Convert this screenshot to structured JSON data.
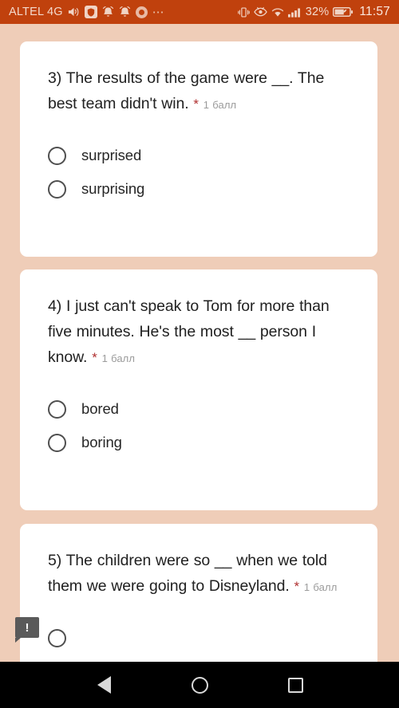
{
  "statusbar": {
    "carrier": "ALTEL 4G",
    "icons_left": [
      "volume-icon",
      "shield-icon",
      "alarm-icon",
      "notification-bell-icon",
      "chrome-icon"
    ],
    "overflow": "⋯",
    "icons_right": [
      "vibrate-icon",
      "eye-icon",
      "wifi-icon",
      "signal-bars-icon"
    ],
    "battery_percent": "32%",
    "battery_icon": "battery-icon",
    "time": "11:57",
    "bg_color": "#c0410d",
    "text_color": "#f3d9cc"
  },
  "theme": {
    "page_bg": "#efcdb8",
    "card_bg": "#ffffff",
    "text_color": "#222222",
    "points_color": "#9b9b9b",
    "required_color": "#b03030"
  },
  "questions": [
    {
      "number": "3)",
      "text": "3) The results of the game were __. The best team didn't win.",
      "points": "1 балл",
      "required_marker": "*",
      "options": [
        {
          "label": "surprised",
          "selected": false
        },
        {
          "label": "surprising",
          "selected": false
        }
      ]
    },
    {
      "number": "4)",
      "text": "4) I just can't speak to Tom for more than five minutes. He's the most __ person I know.",
      "points": "1 балл",
      "required_marker": "*",
      "options": [
        {
          "label": "bored",
          "selected": false
        },
        {
          "label": "boring",
          "selected": false
        }
      ]
    },
    {
      "number": "5)",
      "text": "5) The children were so __ when we told them we were going to Disneyland.",
      "points": "1 балл",
      "required_marker": "*",
      "options": []
    }
  ],
  "warning_bubble": {
    "icon": "exclamation-icon",
    "glyph": "!"
  },
  "navbar": {
    "back": "back-icon",
    "home": "home-icon",
    "recents": "recents-icon"
  }
}
